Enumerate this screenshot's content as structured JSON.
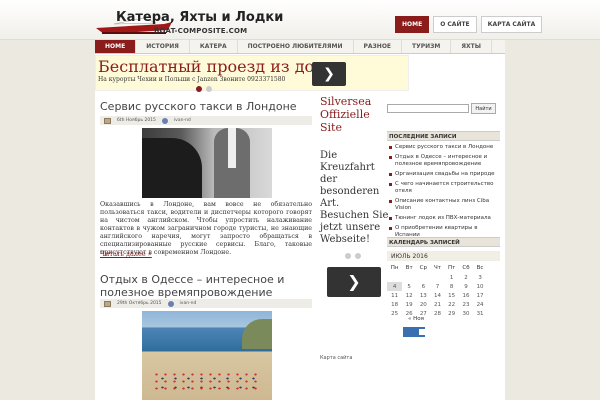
{
  "header": {
    "site_title": "Катера, Яхты и Лодки",
    "site_sub": "BOAT-COMPOSITE.COM",
    "top_links": [
      "HOME",
      "О САЙТЕ",
      "КАРТА САЙТА"
    ]
  },
  "nav": {
    "items": [
      "HOME",
      "ИСТОРИЯ",
      "КАТЕРА",
      "ПОСТРОЕНО ЛЮБИТЕЛЯМИ",
      "РАЗНОЕ",
      "ТУРИЗМ",
      "ЯХТЫ"
    ]
  },
  "ad_top": {
    "title": "Бесплатный проезд из до",
    "text": "На курорты Чехии и Польши с Janzen Звоните 0923371580",
    "button": "❯"
  },
  "posts": [
    {
      "title": "Сервис русского такси в Лондоне",
      "date": "6th Ноябрь 2015",
      "author": "ivan-nd",
      "body": "Оказавшись в Лондоне, вам вовсе не обязательно пользоваться такси, водители и диспетчеры которого говорят на чистом английском. Чтобы упростить налаживание контактов в чужом заграничном городе туристы, не знающие английского наречия, могут запросто обращаться в специализированные русские сервисы. Благо, таковые присутствуют в современном Лондоне.",
      "read_more": "Читать далее »"
    },
    {
      "title": "Отдых в Одессе – интересное и полезное времяпровождение",
      "date": "29th Октябрь 2015",
      "author": "ivan-nd"
    }
  ],
  "ad_side": {
    "title": "Silversea Offizielle Site",
    "text": "Die Kreuzfahrt der besonderen Art. Besuchen Sie jetzt unsere Webseite!",
    "button": "❯",
    "footer": "Карта сайта"
  },
  "sidebar": {
    "search_placeholder": "",
    "search_button": "Найти",
    "recent_heading": "ПОСЛЕДНИЕ ЗАПИСИ",
    "recent": [
      "Сервис русского такси в Лондоне",
      "Отдых в Одессе – интересное и полезное времяпровождение",
      "Организация свадьбы на природе",
      "С чего начинается строительство отеля",
      "Описание контактных линз Ciba Vision",
      "Тюнинг лодок из ПВХ-материала",
      "О приобретении квартиры в Испании"
    ],
    "calendar_heading": "КАЛЕНДАРЬ ЗАПИСЕЙ",
    "calendar_month": "ИЮЛЬ 2016",
    "weekdays": [
      "Пн",
      "Вт",
      "Ср",
      "Чт",
      "Пт",
      "Сб",
      "Вс"
    ],
    "weeks": [
      [
        "",
        "",
        "",
        "",
        "1",
        "2",
        "3"
      ],
      [
        "4",
        "5",
        "6",
        "7",
        "8",
        "9",
        "10"
      ],
      [
        "11",
        "12",
        "13",
        "14",
        "15",
        "16",
        "17"
      ],
      [
        "18",
        "19",
        "20",
        "21",
        "22",
        "23",
        "24"
      ],
      [
        "25",
        "26",
        "27",
        "28",
        "29",
        "30",
        "31"
      ]
    ],
    "calendar_prev": "« Ноя"
  }
}
